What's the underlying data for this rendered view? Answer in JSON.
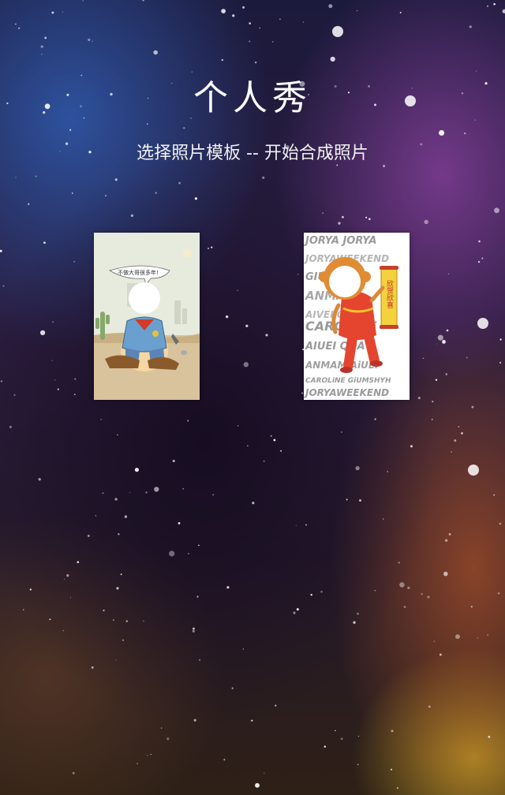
{
  "page": {
    "title": "个人秀",
    "subtitle": "选择照片模板 -- 开始合成照片"
  },
  "templates": [
    {
      "name": "cowboy-template",
      "speech_text": "不做大哥很多年!"
    },
    {
      "name": "monkey-template",
      "scroll_text": "欣贺欣喜",
      "pattern_words": [
        "JORYA JORYA",
        "JORYAWEEKEND",
        "GIUMSHYH",
        "ANMAN",
        "AIVEI QDA",
        "CAROLINE",
        "AIUEI QDA",
        "ANMAM AiUEi",
        "CAROLiNE GiUMSHYH",
        "JORYAWEEKEND"
      ]
    }
  ],
  "colors": {
    "accent_title": "#ffffff"
  }
}
